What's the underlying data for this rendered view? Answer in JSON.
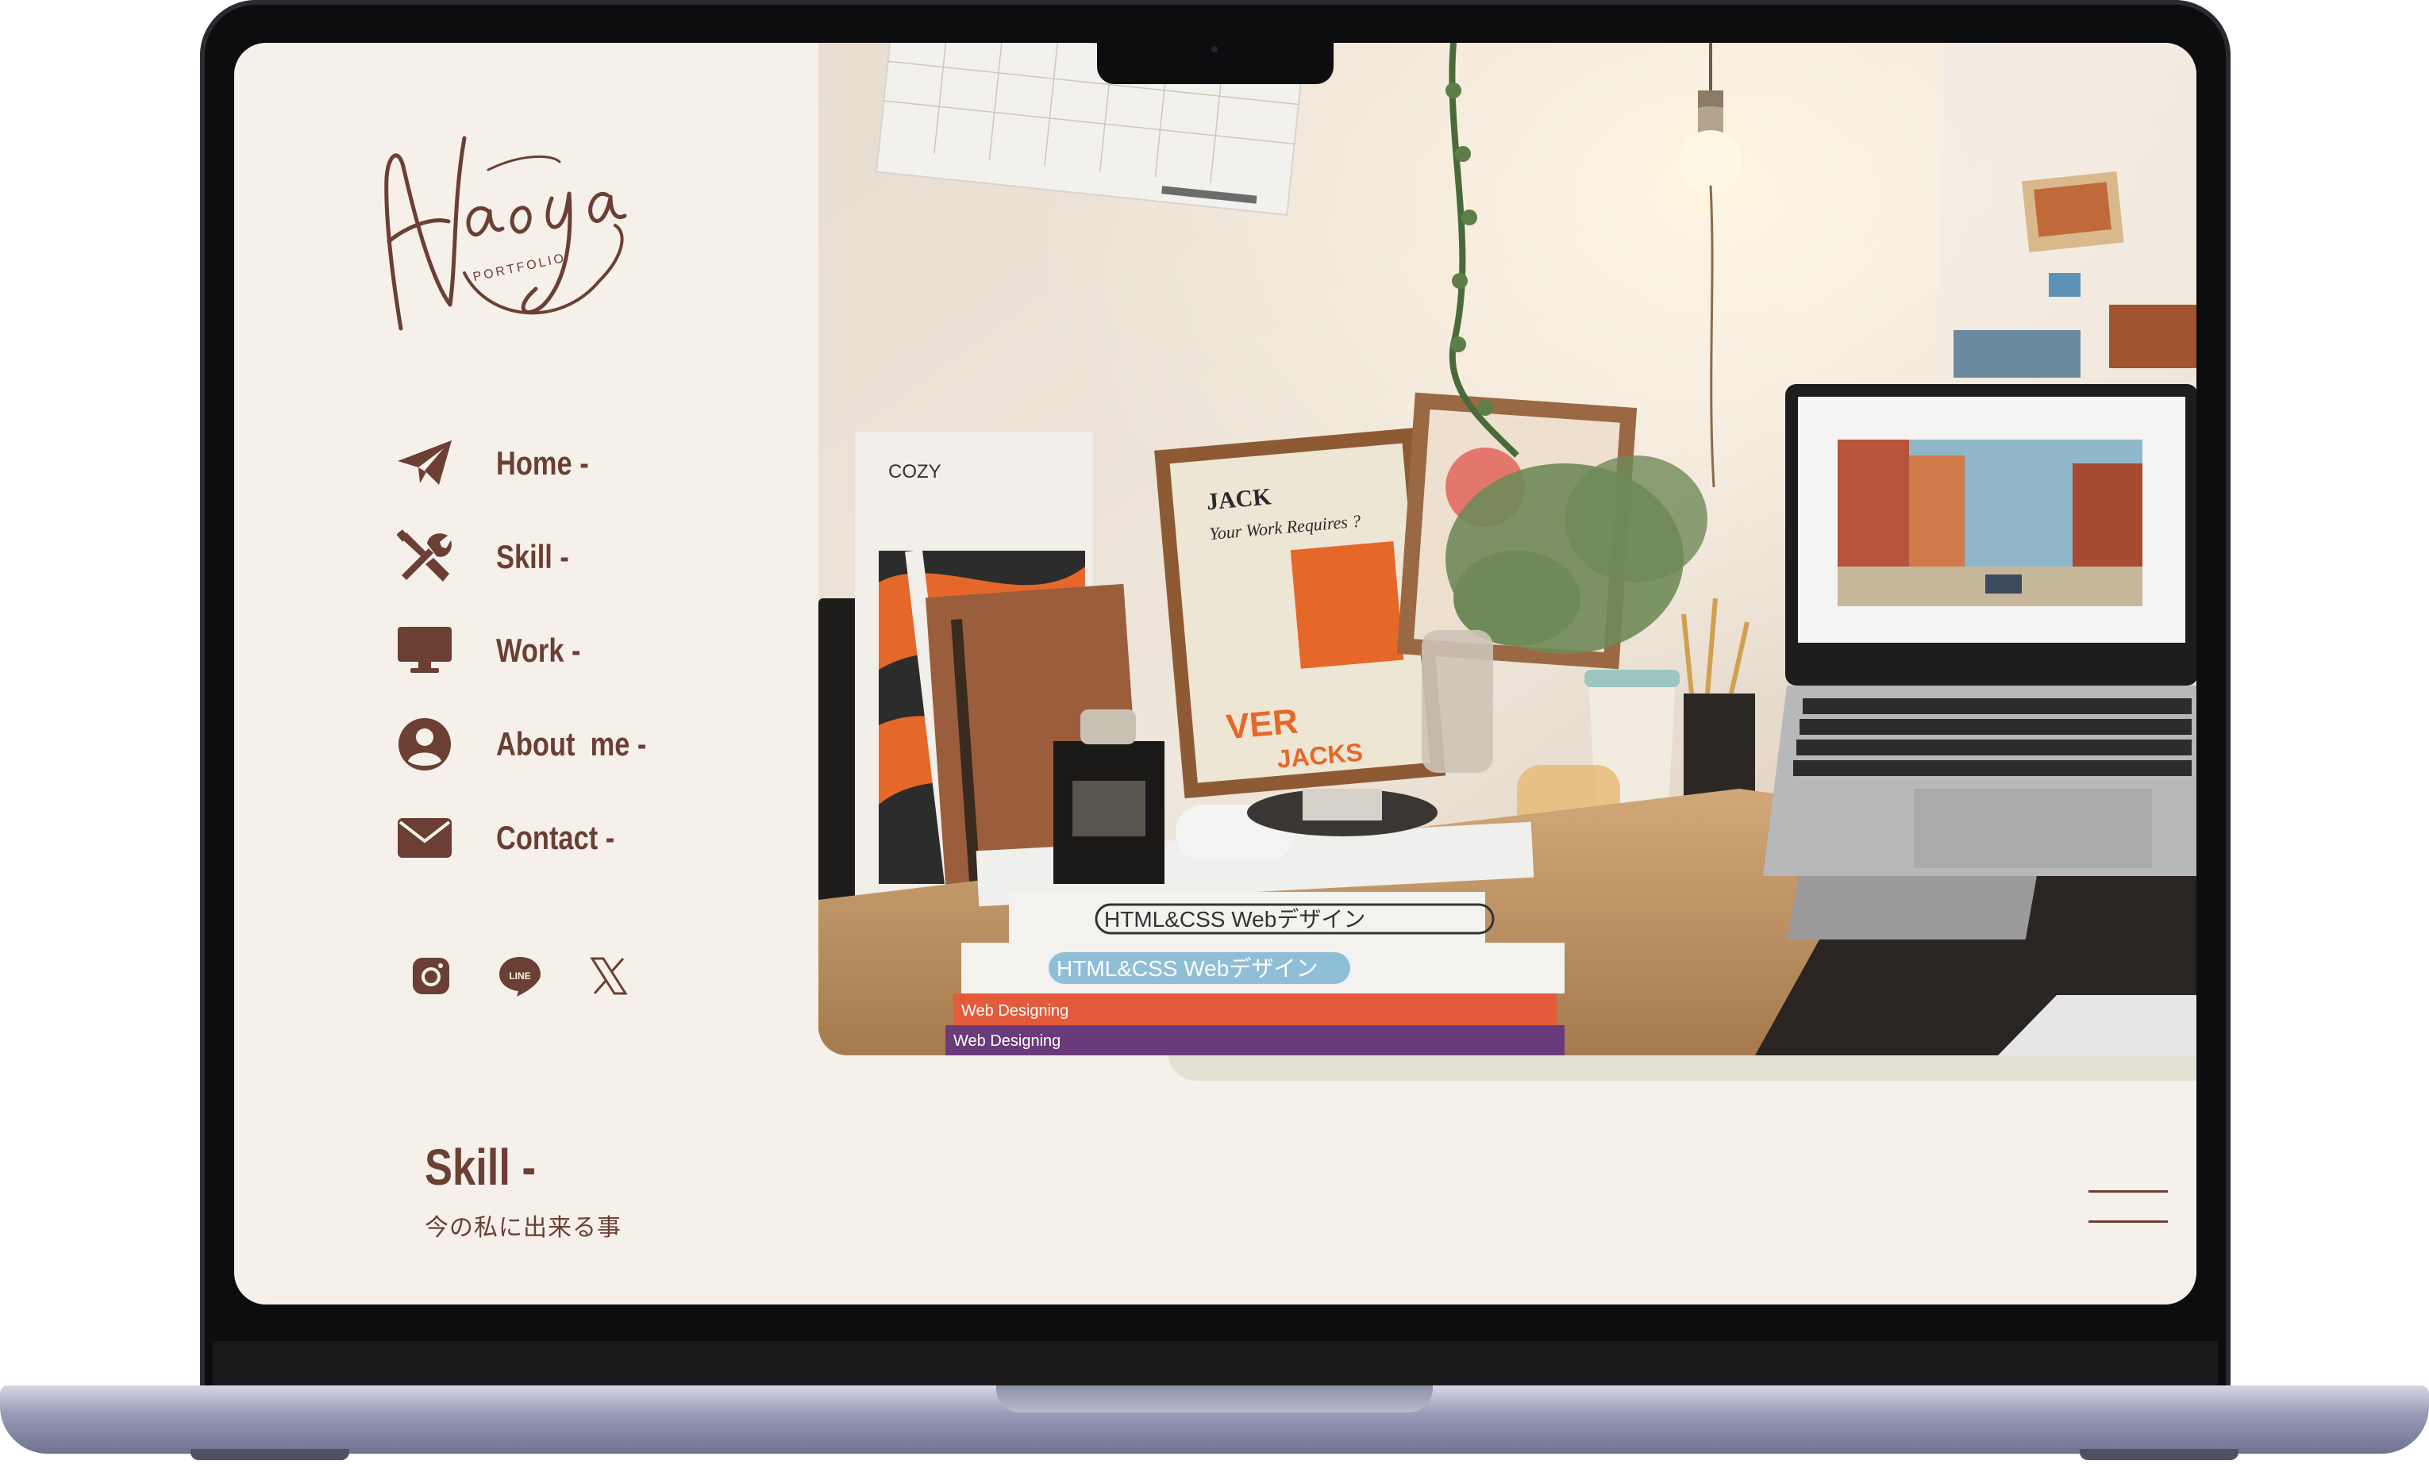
{
  "brand": {
    "logo_text": "Naoya",
    "logo_subtext": "PORTFOLIO",
    "color": "#6b3f33"
  },
  "nav": {
    "items": [
      {
        "label": "Home -",
        "icon": "paper-plane-icon"
      },
      {
        "label": "Skill -",
        "icon": "tools-icon"
      },
      {
        "label": "Work -",
        "icon": "monitor-icon"
      },
      {
        "label": "About  me -",
        "icon": "user-circle-icon"
      },
      {
        "label": "Contact -",
        "icon": "envelope-icon"
      }
    ]
  },
  "social": {
    "items": [
      {
        "name": "instagram",
        "icon": "instagram-icon"
      },
      {
        "name": "line",
        "icon": "line-icon",
        "badge": "LINE"
      },
      {
        "name": "x",
        "icon": "x-icon"
      }
    ]
  },
  "hero": {
    "photo_description_icon": "desk-workspace-photo",
    "book_titles": [
      "HTML&CSS Webデザイン",
      "HTML&CSS Webデザイン",
      "Web Designing",
      "Web Designing"
    ],
    "sign_texts": [
      "JACK",
      "Your Work Requires ?",
      "VER",
      "JACKS",
      "COZY"
    ]
  },
  "section": {
    "title": "Skill -",
    "subtitle": "今の私に出来る事"
  },
  "colors": {
    "background": "#f5f1ea",
    "accent": "#6b3f33",
    "shadow_panel": "#e5e0d4"
  }
}
